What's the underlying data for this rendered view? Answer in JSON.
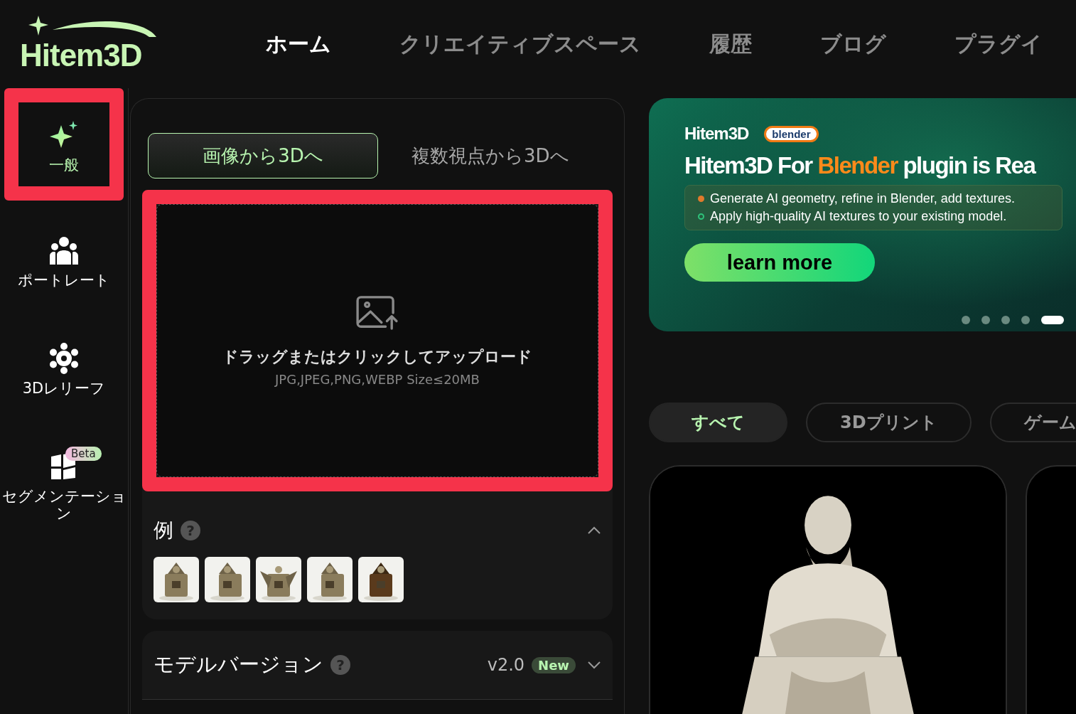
{
  "logo": {
    "text": "Hitem3D"
  },
  "nav": [
    {
      "label": "ホーム",
      "selected": true
    },
    {
      "label": "クリエイティブスペース",
      "selected": false
    },
    {
      "label": "履歴",
      "selected": false
    },
    {
      "label": "ブログ",
      "selected": false
    },
    {
      "label": "プラグイ",
      "selected": false
    }
  ],
  "sidebar": {
    "items": [
      {
        "kind": "sparkle",
        "label": "一般",
        "selected": true,
        "highlighted": true
      },
      {
        "kind": "people",
        "label": "ポートレート",
        "selected": false,
        "highlighted": false
      },
      {
        "kind": "gear",
        "label": "3Dレリーフ",
        "selected": false,
        "highlighted": false
      },
      {
        "kind": "segments",
        "label": "セグメンテーション",
        "selected": false,
        "highlighted": false,
        "badge": "Beta"
      }
    ]
  },
  "tabs": [
    {
      "label": "画像から3Dへ",
      "selected": true
    },
    {
      "label": "複数視点から3Dへ",
      "selected": false
    }
  ],
  "upload": {
    "highlighted": true,
    "title": "ドラッグまたはクリックしてアップロード",
    "hint": "JPG,JPEG,PNG,WEBP Size≤20MB"
  },
  "examples": {
    "title": "例",
    "help": "?",
    "expanded": true
  },
  "model_version": {
    "label": "モデルバージョン",
    "help": "?",
    "value": "v2.0",
    "badge": "New"
  },
  "banner": {
    "brand": "Hitem3D",
    "partner": "blender",
    "headline": [
      {
        "text": "Hitem3D For",
        "highlight": false
      },
      {
        "text": "Blender",
        "highlight": true
      },
      {
        "text": "plugin is Rea",
        "highlight": false
      }
    ],
    "bullets": [
      {
        "text": "Generate AI geometry, refine in Blender, add textures.",
        "color": "#e07a2c"
      },
      {
        "text": "Apply high-quality AI textures to your existing model.",
        "color": "#2ec27a"
      }
    ],
    "button": "learn more",
    "slides": [
      {
        "selected": false
      },
      {
        "selected": false
      },
      {
        "selected": false
      },
      {
        "selected": false
      },
      {
        "selected": true
      }
    ]
  },
  "filters": [
    {
      "label": "すべて",
      "selected": true
    },
    {
      "label": "3Dプリント",
      "selected": false
    },
    {
      "label": "ゲーム",
      "selected": false
    }
  ]
}
